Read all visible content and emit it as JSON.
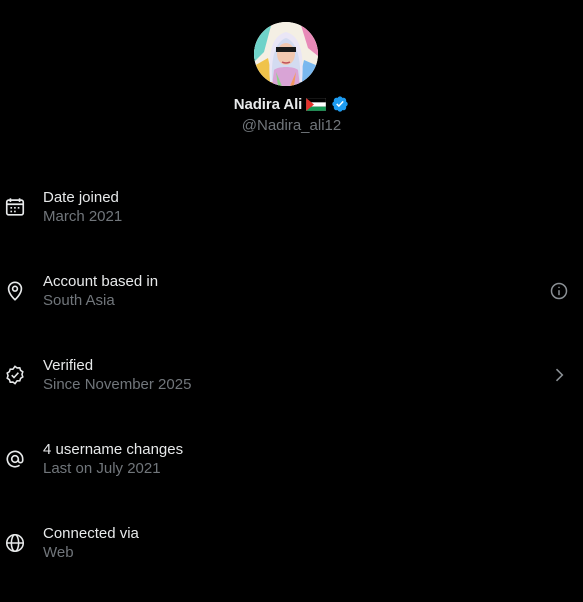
{
  "profile": {
    "display_name": "Nadira Ali",
    "handle": "@Nadira_ali12",
    "flag_icon": "palestine-flag-icon",
    "verified_icon": "verified-badge-icon",
    "verified_color": "#1d9bf0"
  },
  "rows": [
    {
      "icon": "calendar-icon",
      "title": "Date joined",
      "subtitle": "March 2021",
      "action_icon": ""
    },
    {
      "icon": "location-pin-icon",
      "title": "Account based in",
      "subtitle": "South Asia",
      "action_icon": "info-icon"
    },
    {
      "icon": "verified-outline-icon",
      "title": "Verified",
      "subtitle": "Since November 2025",
      "action_icon": "chevron-right-icon"
    },
    {
      "icon": "at-sign-icon",
      "title": "4 username changes",
      "subtitle": "Last on July 2021",
      "action_icon": ""
    },
    {
      "icon": "globe-icon",
      "title": "Connected via",
      "subtitle": "Web",
      "action_icon": ""
    }
  ],
  "colors": {
    "background": "#000000",
    "primary_text": "#e7e9ea",
    "secondary_text": "#71767b"
  }
}
